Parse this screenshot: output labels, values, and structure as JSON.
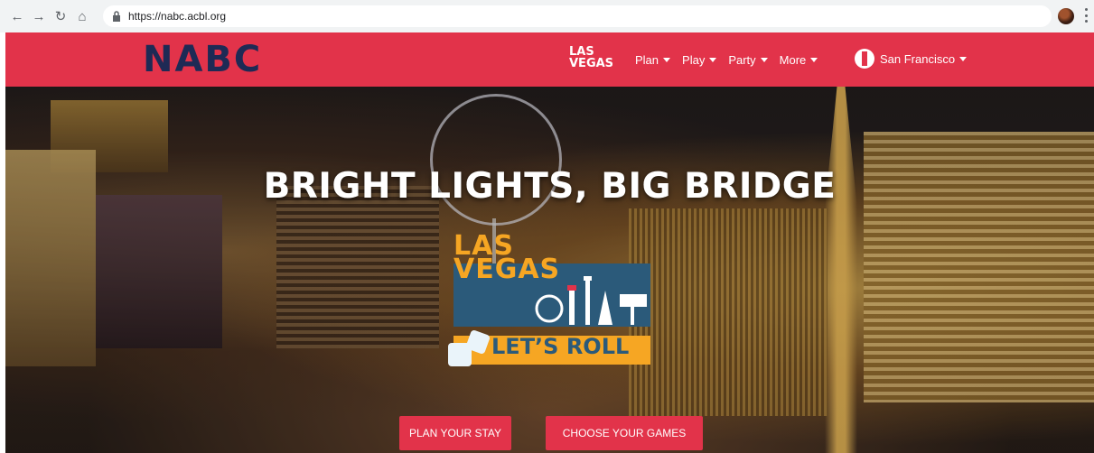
{
  "browser": {
    "url": "https://nabc.acbl.org"
  },
  "header": {
    "logo_text": "NABC",
    "lasvegas_mini": [
      "LAS",
      "VEGAS"
    ],
    "menu": [
      {
        "label": "Plan"
      },
      {
        "label": "Play"
      },
      {
        "label": "Party"
      },
      {
        "label": "More"
      }
    ],
    "city": "San Francisco",
    "colors": {
      "brand_red": "#e2334a",
      "logo_navy": "#1e2a55"
    }
  },
  "hero": {
    "title": "BRIGHT LIGHTS, BIG BRIDGE",
    "logo_lines": [
      "LAS",
      "VEGAS"
    ],
    "tagline": "LET’S ROLL",
    "buttons": {
      "plan": "PLAN YOUR STAY",
      "games": "CHOOSE YOUR GAMES"
    },
    "colors": {
      "orange": "#f6a623",
      "teal": "#2b5a7a"
    }
  }
}
